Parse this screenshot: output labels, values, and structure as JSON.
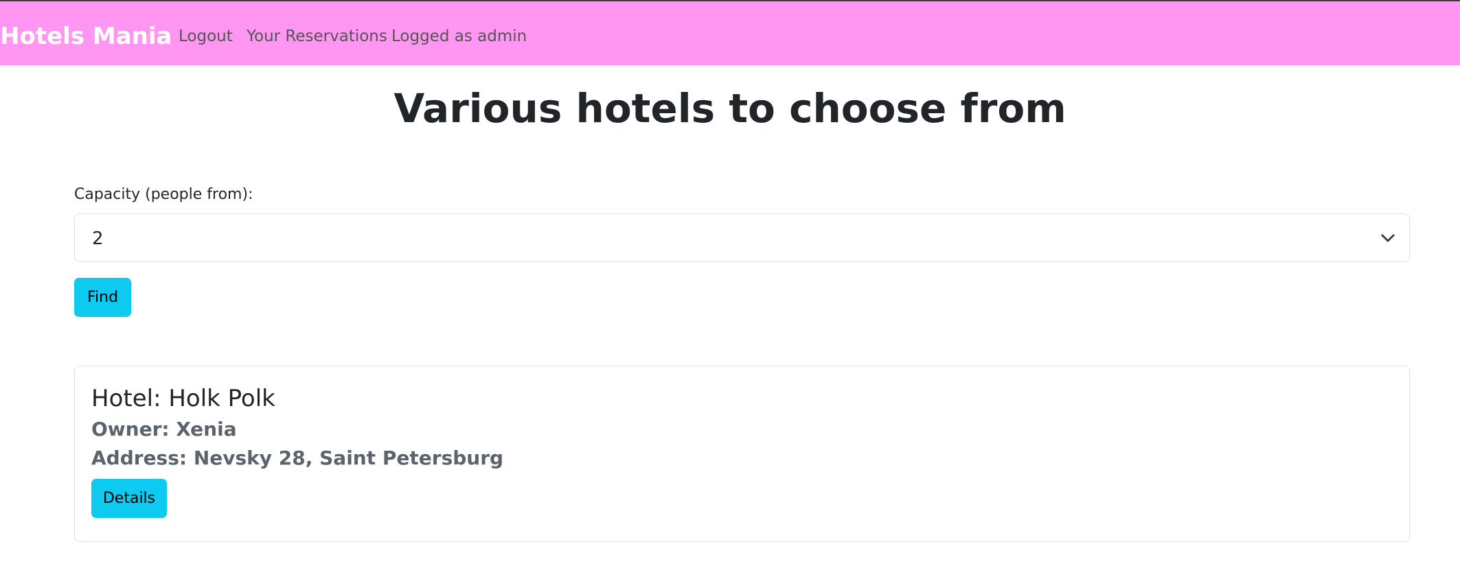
{
  "navbar": {
    "brand": "Hotels Mania",
    "links": [
      {
        "label": "Logout"
      },
      {
        "label": "Your Reservations"
      },
      {
        "label": "Logged as admin"
      }
    ],
    "background_color": "#ff96f1"
  },
  "main": {
    "title": "Various hotels to choose from",
    "filter": {
      "label": "Capacity (people from):",
      "selected_value": "2",
      "icon": "chevron-down-icon",
      "find_label": "Find"
    },
    "hotels": [
      {
        "name": "Hotel: Holk Polk",
        "owner": "Owner: Xenia",
        "address": "Address: Nevsky 28, Saint Petersburg",
        "details_label": "Details"
      }
    ],
    "accent_color": "#0dcaf0"
  }
}
